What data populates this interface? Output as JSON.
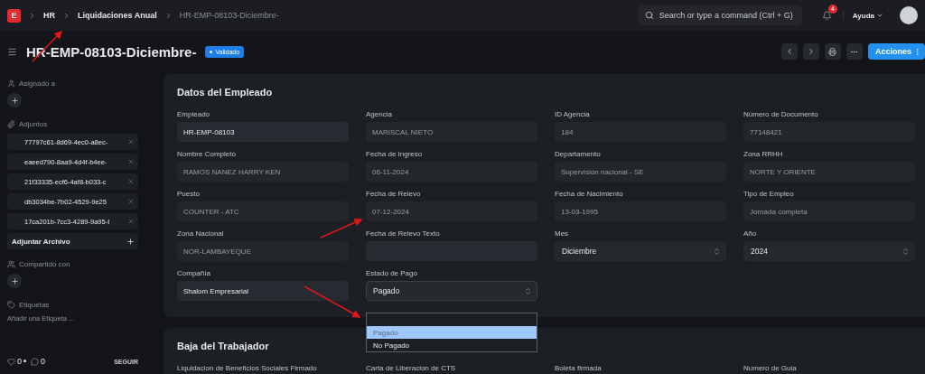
{
  "logo": "E",
  "breadcrumbs": [
    "HR",
    "Liquidaciones Anual",
    "HR-EMP-08103-Diciembre-"
  ],
  "search": {
    "placeholder": "Search or type a command (Ctrl + G)"
  },
  "notifications": {
    "count": "4"
  },
  "help_menu": {
    "label": "Ayuda"
  },
  "page": {
    "title": "HR-EMP-08103-Diciembre-",
    "status": "Validado",
    "actions_label": "Acciones"
  },
  "sidebar": {
    "assigned_label": "Asignado a",
    "attachments_label": "Adjuntos",
    "attachments": [
      "77797c61-8d69-4ec0-a8ec-",
      "eaeed790-8aa9-4d4f-b4ee-",
      "21f33335-ecf6-4af8-b033-c",
      "db3034be-7b02-4529-9e25",
      "17ca201b-7cc3-4289-9a95-t"
    ],
    "attach_button": "Adjuntar Archivo",
    "shared_label": "Compartido con",
    "tags_label": "Etiquetas",
    "add_tag": "Añadir una Etiqueta ...",
    "likes": "0",
    "comments": "0",
    "follow": "SEGUIR"
  },
  "sections": [
    {
      "title": "Datos del Empleado",
      "columns": [
        [
          {
            "label": "Empleado",
            "value": "HR-EMP-08103",
            "kind": "input",
            "disabled": false
          },
          {
            "label": "Nombre Completo",
            "value": "RAMOS NANEZ HARRY KEN",
            "kind": "input",
            "disabled": true
          },
          {
            "label": "Puesto",
            "value": "COUNTER - ATC",
            "kind": "input",
            "disabled": true
          },
          {
            "label": "Zona Nacional",
            "value": "NOR-LAMBAYEQUE",
            "kind": "input",
            "disabled": true
          },
          {
            "label": "Compañía",
            "value": "Shalom Empresarial",
            "kind": "input",
            "disabled": false
          }
        ],
        [
          {
            "label": "Agencia",
            "value": "MARISCAL NIETO",
            "kind": "input",
            "disabled": true
          },
          {
            "label": "Fecha de Ingreso",
            "value": "06-11-2024",
            "kind": "input",
            "disabled": true
          },
          {
            "label": "Fecha de Relevo",
            "value": "07-12-2024",
            "kind": "input",
            "disabled": true
          },
          {
            "label": "Fecha de Relevo Texto",
            "kind": "input"
          },
          {
            "label": "Estado de Pago",
            "value": "Pagado",
            "kind": "select",
            "expanded": true,
            "options": [
              {
                "label": "Pagado",
                "selected": true
              },
              {
                "label": "No Pagado",
                "selected": false
              }
            ]
          }
        ],
        [
          {
            "label": "ID Agencia",
            "value": "184",
            "kind": "input",
            "disabled": true
          },
          {
            "label": "Departamento",
            "value": "Supervisión nacional - SE",
            "kind": "input",
            "disabled": true
          },
          {
            "label": "Fecha de Nacimiento",
            "value": "13-03-1995",
            "kind": "input",
            "disabled": true
          },
          {
            "label": "Mes",
            "value": "Diciembre",
            "kind": "select",
            "expanded": false
          }
        ],
        [
          {
            "label": "Número de Documento",
            "value": "77148421",
            "kind": "input",
            "disabled": true
          },
          {
            "label": "Zona RRHH",
            "value": "NORTE Y ORIENTE",
            "kind": "input",
            "disabled": true
          },
          {
            "label": "Tipo de Empleo",
            "value": "Jornada completa",
            "kind": "input",
            "disabled": true
          },
          {
            "label": "Año",
            "value": "2024",
            "kind": "select",
            "expanded": false
          }
        ]
      ]
    },
    {
      "title": "Baja del Trabajador",
      "columns": [
        [
          {
            "label": "Liquidacion de Beneficios Sociales Firmado",
            "kind": "label"
          }
        ],
        [
          {
            "label": "Carta de Liberacion de CTS",
            "kind": "label"
          }
        ],
        [
          {
            "label": "Boleta firmada",
            "kind": "label"
          }
        ],
        [
          {
            "label": "Numero de Guia",
            "kind": "label"
          }
        ]
      ]
    }
  ]
}
